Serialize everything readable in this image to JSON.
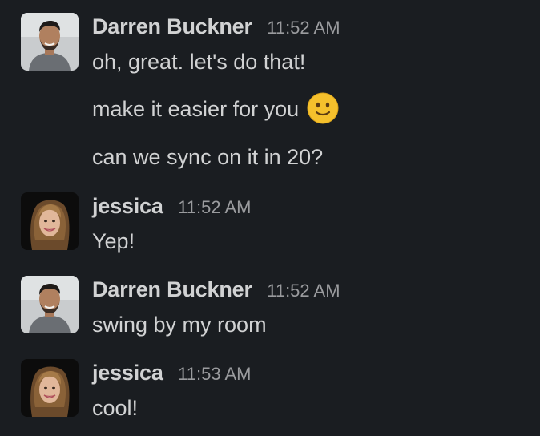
{
  "messages": [
    {
      "author": "Darren Buckner",
      "time": "11:52 AM",
      "lines": [
        "oh, great. let's do that!",
        "make it easier for you",
        "can we sync on it in 20?"
      ],
      "avatar": "darren-avatar"
    },
    {
      "author": "jessica",
      "time": "11:52 AM",
      "lines": [
        "Yep!"
      ],
      "avatar": "jessica-avatar"
    },
    {
      "author": "Darren Buckner",
      "time": "11:52 AM",
      "lines": [
        "swing by my room"
      ],
      "avatar": "darren-avatar"
    },
    {
      "author": "jessica",
      "time": "11:53 AM",
      "lines": [
        "cool!"
      ],
      "avatar": "jessica-avatar"
    }
  ],
  "emoji": "slightly-smiling-face-icon",
  "colors": {
    "background": "#1a1d21",
    "text": "#d1d2d3",
    "timestamp": "#9a9b9e",
    "emoji": "#f5c02c"
  }
}
